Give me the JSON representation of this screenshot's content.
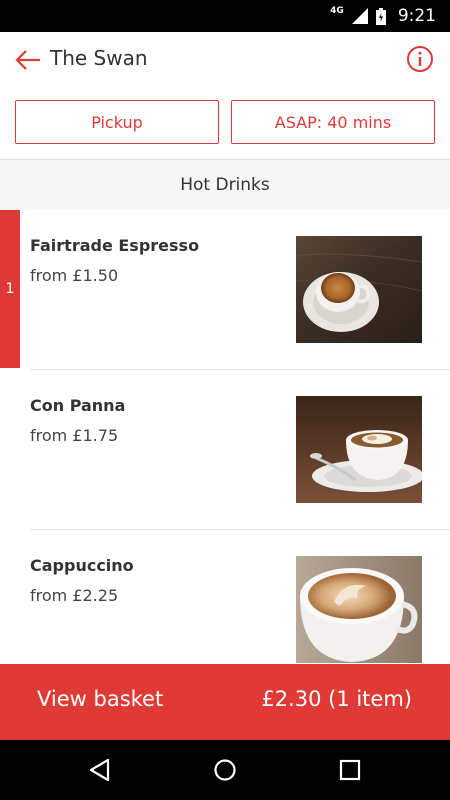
{
  "status_bar": {
    "network": "4G",
    "time": "9:21"
  },
  "header": {
    "title": "The Swan",
    "back_icon": "arrow-left-icon",
    "info_icon": "info-circle-icon"
  },
  "options": {
    "mode_label": "Pickup",
    "time_label": "ASAP: 40 mins"
  },
  "category": {
    "title": "Hot Drinks"
  },
  "items": [
    {
      "name": "Fairtrade Espresso",
      "price": "from £1.50",
      "quantity": "1"
    },
    {
      "name": "Con Panna",
      "price": "from £1.75"
    },
    {
      "name": "Cappuccino",
      "price": "from £2.25"
    }
  ],
  "basket": {
    "label": "View basket",
    "total": "£2.30 (1 item)"
  },
  "colors": {
    "accent": "#e03a37",
    "category_bg": "#f6f6f6",
    "text": "#333333"
  },
  "nav": {
    "back_icon": "triangle-back-icon",
    "home_icon": "circle-home-icon",
    "recent_icon": "square-recents-icon"
  }
}
